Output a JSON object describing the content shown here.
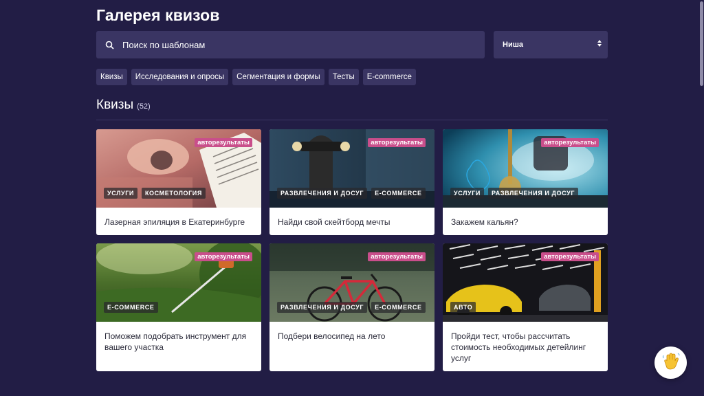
{
  "page": {
    "title": "Галерея квизов"
  },
  "search": {
    "placeholder": "Поиск по шаблонам"
  },
  "niche_select": {
    "value": "Ниша"
  },
  "filters": [
    "Квизы",
    "Исследования и опросы",
    "Сегментация и формы",
    "Тесты",
    "E-commerce"
  ],
  "section": {
    "title": "Квизы",
    "count": "(52)"
  },
  "cards": [
    {
      "badge": "авторезультаты",
      "tags": [
        "УСЛУГИ",
        "КОСМЕТОЛОГИЯ"
      ],
      "title": "Лазерная эпиляция в Екатеринбурге",
      "image": "cosmetology-photo"
    },
    {
      "badge": "авторезультаты",
      "tags": [
        "РАЗВЛЕЧЕНИЯ И ДОСУГ",
        "E-COMMERCE"
      ],
      "title": "Найди свой скейтборд мечты",
      "image": "longboard-photo"
    },
    {
      "badge": "авторезультаты",
      "tags": [
        "УСЛУГИ",
        "РАЗВЛЕЧЕНИЯ И ДОСУГ"
      ],
      "title": "Закажем кальян?",
      "image": "hookah-photo"
    },
    {
      "badge": "авторезультаты",
      "tags": [
        "E-COMMERCE"
      ],
      "title": "Поможем подобрать инструмент для вашего участка",
      "image": "garden-trimmer-photo"
    },
    {
      "badge": "авторезультаты",
      "tags": [
        "РАЗВЛЕЧЕНИЯ И ДОСУГ",
        "E-COMMERCE"
      ],
      "title": "Подбери велосипед на лето",
      "image": "bicycle-photo"
    },
    {
      "badge": "авторезультаты",
      "tags": [
        "АВТО"
      ],
      "title": "Пройди тест, чтобы рассчитать стоимость необходимых детейлинг услуг",
      "image": "car-detailing-photo"
    }
  ],
  "colors": {
    "background": "#221d45",
    "panel": "#3a3563",
    "badge": "#c94e8b"
  },
  "help_button": {
    "icon": "waving-hand-icon"
  }
}
